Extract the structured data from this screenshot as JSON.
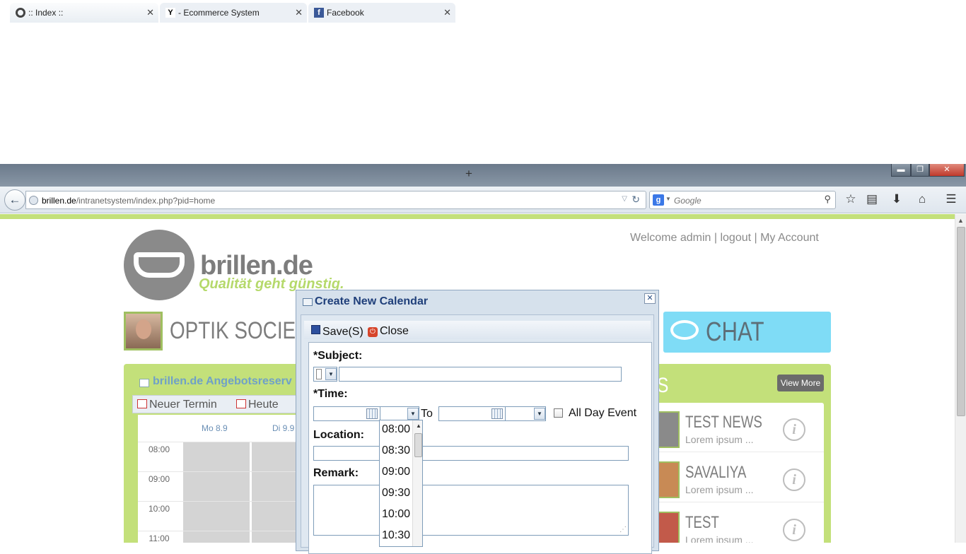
{
  "browser": {
    "tabs": [
      {
        "title": ":: Index ::",
        "active": true,
        "icon": "firefox-icon"
      },
      {
        "title": "- Ecommerce System",
        "active": false,
        "icon": "y-icon"
      },
      {
        "title": "Facebook",
        "active": false,
        "icon": "facebook-icon"
      }
    ],
    "new_tab": "+",
    "url_host": "brillen.de",
    "url_path": "/intranetsystem/index.php?pid=home",
    "search_placeholder": "Google",
    "search_engine_letter": "g"
  },
  "header": {
    "welcome": "Welcome admin | logout | My Account"
  },
  "logo": {
    "text": "brillen.de",
    "tagline": "Qualität geht günstig."
  },
  "society": {
    "title": "OPTIK SOCIETY"
  },
  "chat": {
    "title": "CHAT"
  },
  "calendar_widget": {
    "title": "brillen.de Angebotsreserv",
    "toolbar": {
      "new": "Neuer Termin",
      "today": "Heute"
    },
    "days": [
      "Mo 8.9",
      "Di 9.9"
    ],
    "times": [
      "08:00",
      "09:00",
      "10:00",
      "11:00"
    ]
  },
  "news_widget": {
    "heading_fragment": "S",
    "view_more": "View More",
    "items": [
      {
        "title": "TEST NEWS",
        "desc": "Lorem ipsum ..."
      },
      {
        "title": "SAVALIYA",
        "desc": "Lorem ipsum ..."
      },
      {
        "title": "TEST",
        "desc": "Lorem ipsum ..."
      }
    ],
    "info_glyph": "i"
  },
  "dialog": {
    "title": "Create New Calendar",
    "close_glyph": "✕",
    "toolbar": {
      "save": "Save(S)",
      "close": "Close"
    },
    "labels": {
      "subject": "*Subject:",
      "time": "*Time:",
      "to": "To",
      "all_day": "All Day Event",
      "location": "Location:",
      "remark": "Remark:"
    },
    "values": {
      "subject": "",
      "start_date": "",
      "start_time": "",
      "end_date": "",
      "end_time": "",
      "location": "",
      "remark": ""
    }
  },
  "time_options": [
    "08:00",
    "08:30",
    "09:00",
    "09:30",
    "10:00",
    "10:30"
  ]
}
